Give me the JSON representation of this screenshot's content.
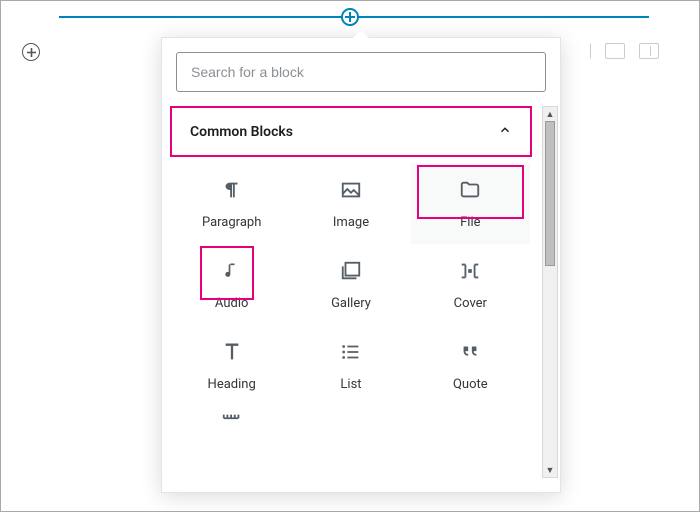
{
  "inserter": {
    "search_placeholder": "Search for a block"
  },
  "panel": {
    "common_blocks_title": "Common Blocks"
  },
  "blocks": {
    "paragraph": "Paragraph",
    "image": "Image",
    "file": "File",
    "audio": "Audio",
    "gallery": "Gallery",
    "cover": "Cover",
    "heading": "Heading",
    "list": "List",
    "quote": "Quote"
  },
  "highlighted": [
    "panel-common-blocks",
    "block-file",
    "block-audio"
  ]
}
